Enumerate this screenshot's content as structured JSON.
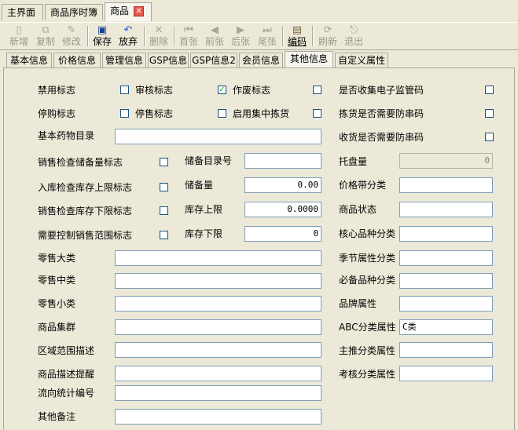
{
  "window_tabs": [
    {
      "label": "主界面"
    },
    {
      "label": "商品序时簿"
    },
    {
      "label": "商品"
    }
  ],
  "toolbar": {
    "new": "新增",
    "copy": "复制",
    "edit": "修改",
    "save": "保存",
    "discard": "放弃",
    "delete": "删除",
    "first": "首张",
    "prev": "前张",
    "next": "后张",
    "last": "尾张",
    "code": "编码",
    "refresh": "刷新",
    "exit": "退出"
  },
  "tabs": [
    "基本信息",
    "价格信息",
    "管理信息",
    "GSP信息",
    "GSP信息2",
    "会员信息",
    "其他信息",
    "自定义属性"
  ],
  "active_tab": "其他信息",
  "form": {
    "disable_flag": "禁用标志",
    "review_flag": "审核标志",
    "void_flag": "作废标志",
    "void_checked": "✓",
    "collect_monitor": "是否收集电子监管码",
    "stop_purchase": "停购标志",
    "stop_sale": "停售标志",
    "central_pick": "启用集中拣货",
    "pick_anti_counterfeit": "拣货是否需要防串码",
    "basic_drug_catalog": "基本药物目录",
    "receive_anti_counterfeit": "收货是否需要防串码",
    "sales_reserve_check": "销售检查储备量标志",
    "reserve_catalog_no": "储备目录号",
    "tray_qty": "托盘量",
    "tray_qty_value": "0",
    "inbound_upper_check": "入库检查库存上限标志",
    "reserve_qty": "储备量",
    "reserve_qty_value": "0.00",
    "price_band_class": "价格带分类",
    "sales_lower_check": "销售检查库存下限标志",
    "stock_upper": "库存上限",
    "stock_upper_value": "0.0000",
    "product_status": "商品状态",
    "sales_range_control": "需要控制销售范围标志",
    "stock_lower": "库存下限",
    "stock_lower_value": "0",
    "core_variety_class": "核心品种分类",
    "retail_major": "零售大类",
    "season_attr_class": "季节属性分类",
    "retail_middle": "零售中类",
    "required_variety_class": "必备品种分类",
    "retail_minor": "零售小类",
    "brand_attr": "品牌属性",
    "product_cluster": "商品集群",
    "abc_class_attr": "ABC分类属性",
    "abc_class_value": "C类",
    "region_desc": "区域范围描述",
    "main_push_class": "主推分类属性",
    "product_desc_tip": "商品描述提醒",
    "assess_class_attr": "考核分类属性",
    "flow_stat_no": "流向统计编号",
    "other_notes": "其他备注"
  }
}
